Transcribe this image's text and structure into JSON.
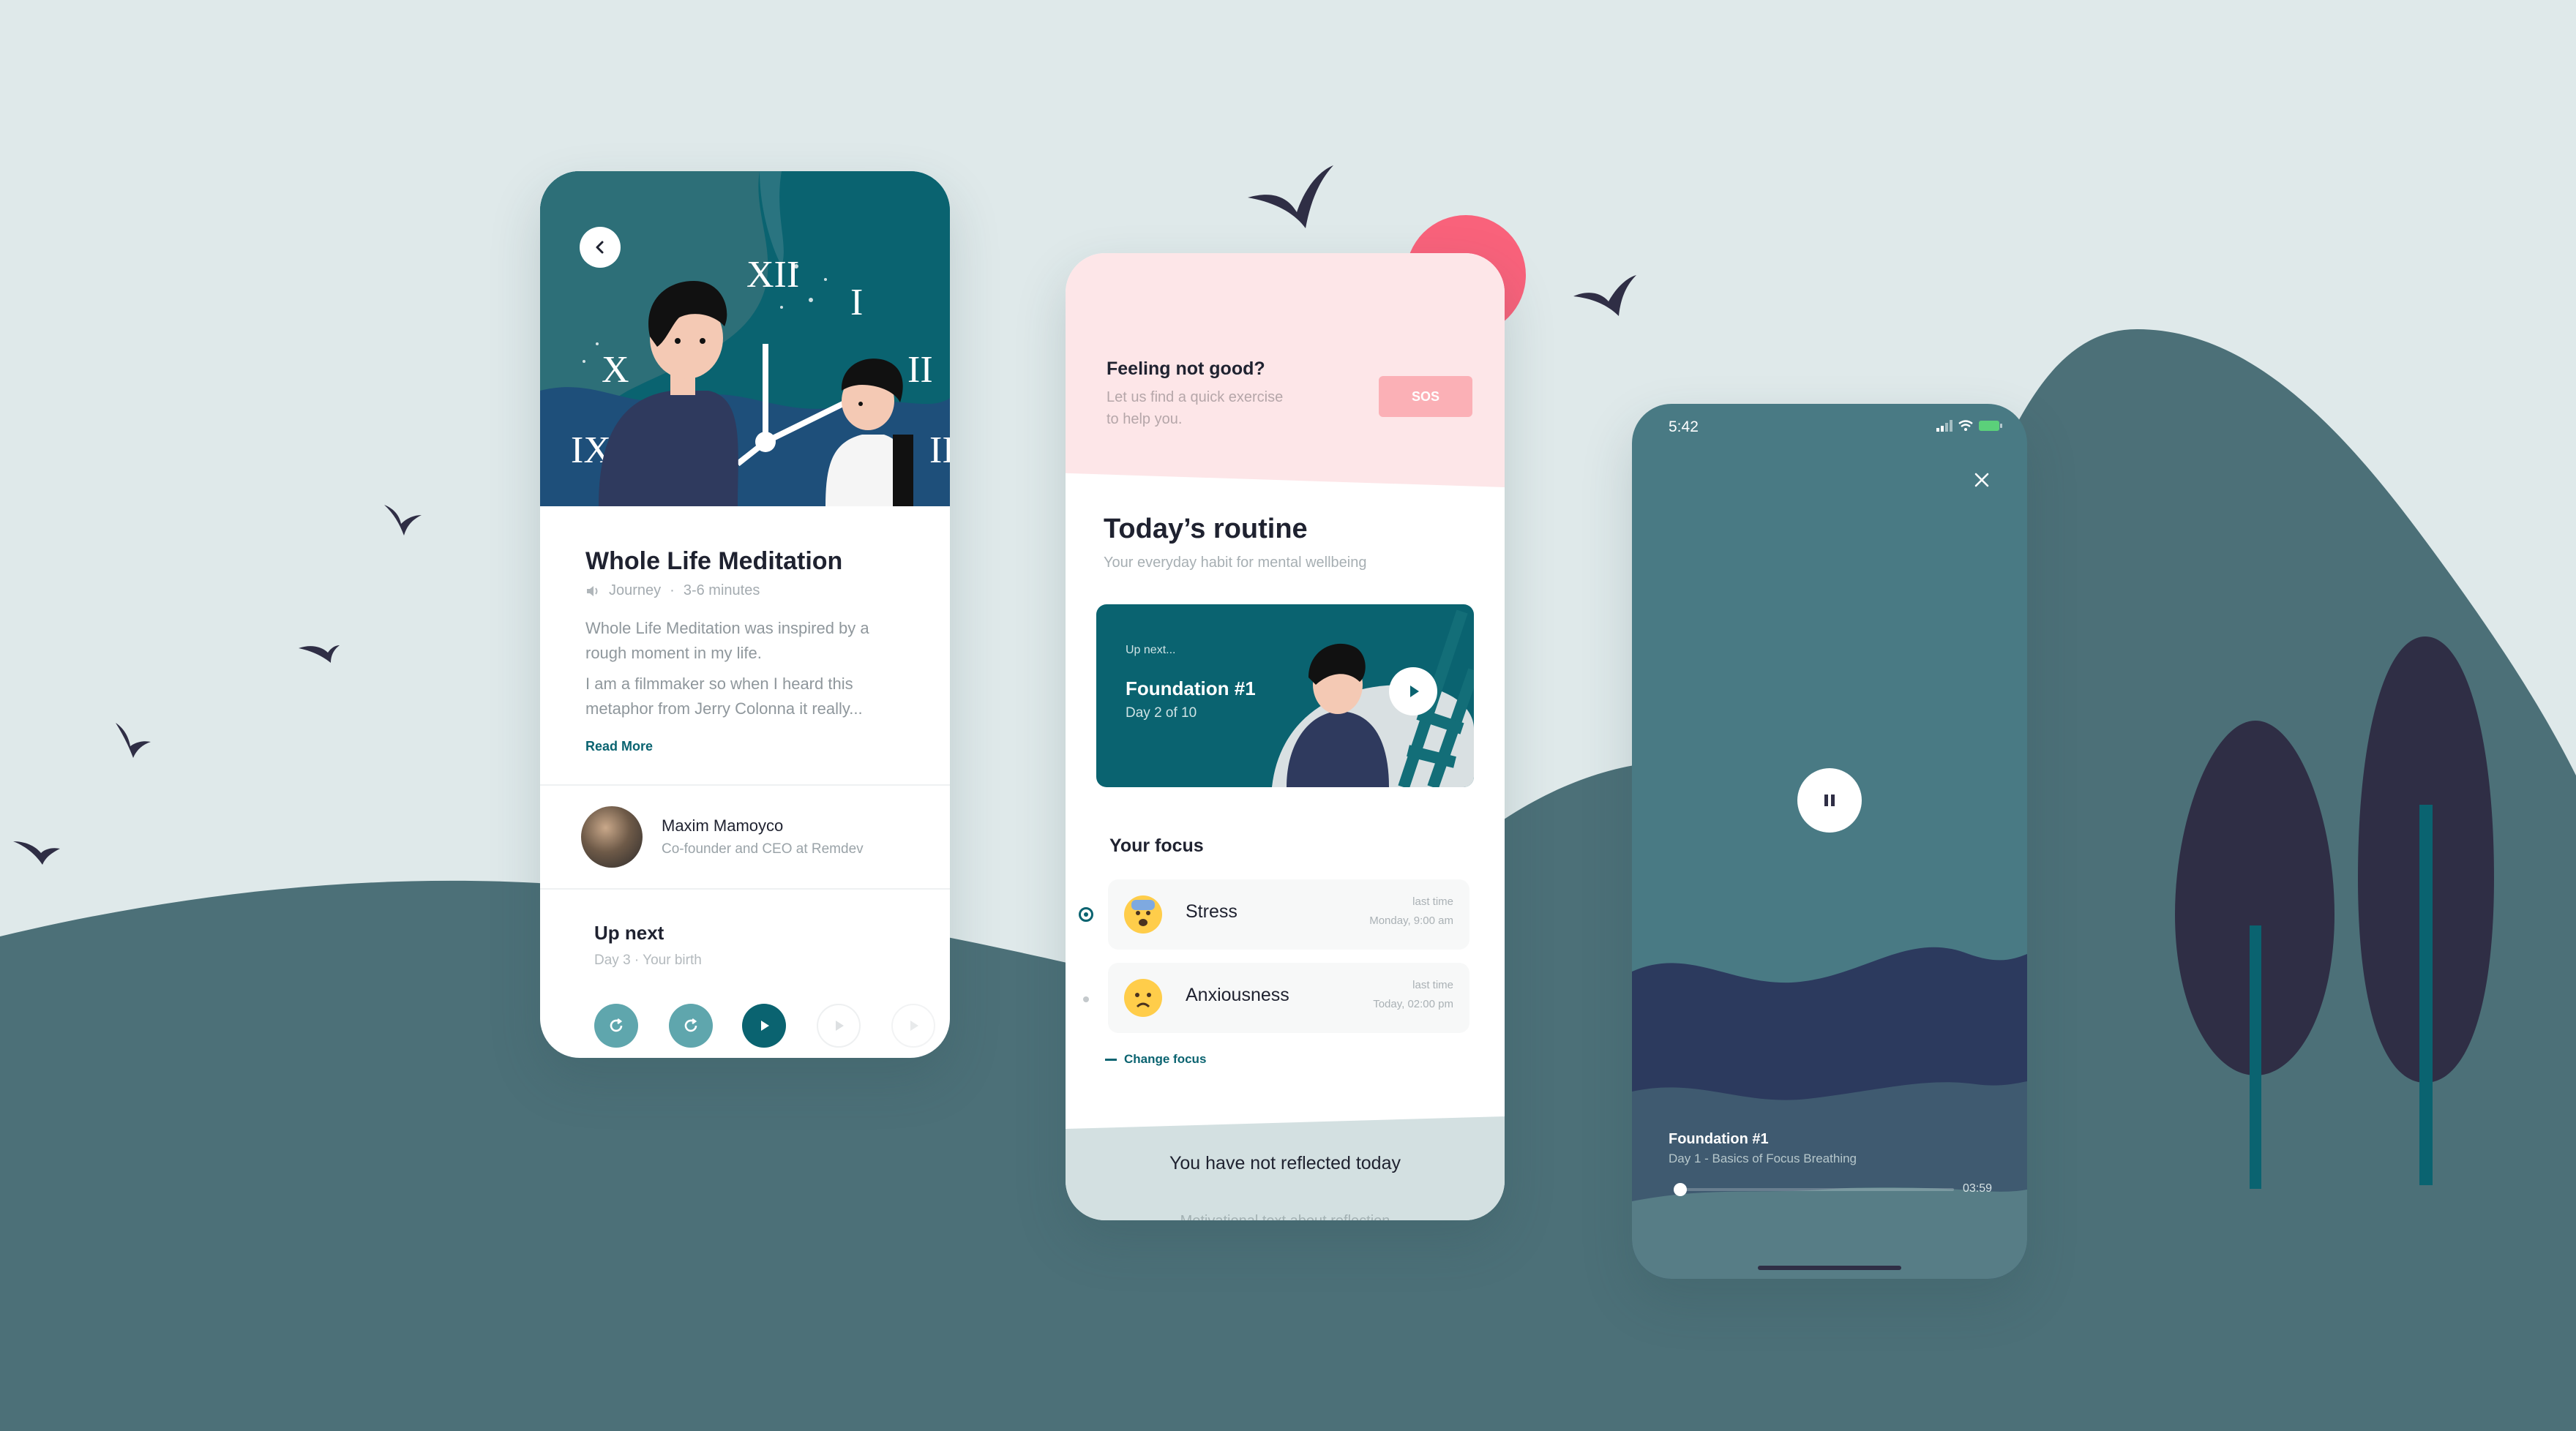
{
  "colors": {
    "background": "#dfe9ea",
    "hill": "#4c7078",
    "teal": "#0a6370",
    "dark": "#2f2e45",
    "coral": "#f9627b",
    "sos": "#fbb0b6",
    "pink_bg": "#fde6e8"
  },
  "screen1": {
    "title": "Whole Life Meditation",
    "meta_type": "Journey",
    "meta_sep": "·",
    "meta_duration": "3-6 minutes",
    "para1": "Whole Life Meditation was inspired by a rough moment in my life.",
    "para2": "I am a filmmaker so when I heard this metaphor from Jerry Colonna it really...",
    "read_more": "Read More",
    "author_name": "Maxim Mamoyco",
    "author_role": "Co-founder and CEO at Remdev",
    "up_next_title": "Up next",
    "up_next_sub": "Day 3 · Your birth",
    "clock_numerals": {
      "top": "XII",
      "left": "X",
      "bottom_left": "IX",
      "right_upper": "II",
      "right_lower": "II",
      "right_top": "I"
    }
  },
  "screen2": {
    "feeling_title": "Feeling not good?",
    "feeling_sub_line1": "Let us find a quick exercise",
    "feeling_sub_line2": "to help you.",
    "sos_label": "SOS",
    "routine_title": "Today’s routine",
    "routine_sub": "Your everyday habit for mental wellbeing",
    "card_up_next": "Up next...",
    "card_title": "Foundation #1",
    "card_sub": "Day 2 of 10",
    "focus_heading": "Your focus",
    "focus_items": [
      {
        "label": "Stress",
        "meta_label": "last time",
        "meta_time": "Monday, 9:00 am",
        "icon": "anxious-face-icon"
      },
      {
        "label": "Anxiousness",
        "meta_label": "last time",
        "meta_time": "Today, 02:00 pm",
        "icon": "worried-face-icon"
      }
    ],
    "change_focus": "Change focus",
    "reflect_title": "You have not reflected today",
    "reflect_sub": "Motivational text about reflection"
  },
  "screen3": {
    "status_time": "5:42",
    "track_title": "Foundation #1",
    "track_sub": "Day 1 - Basics of Focus Breathing",
    "duration": "03:59",
    "progress": 0.02
  }
}
